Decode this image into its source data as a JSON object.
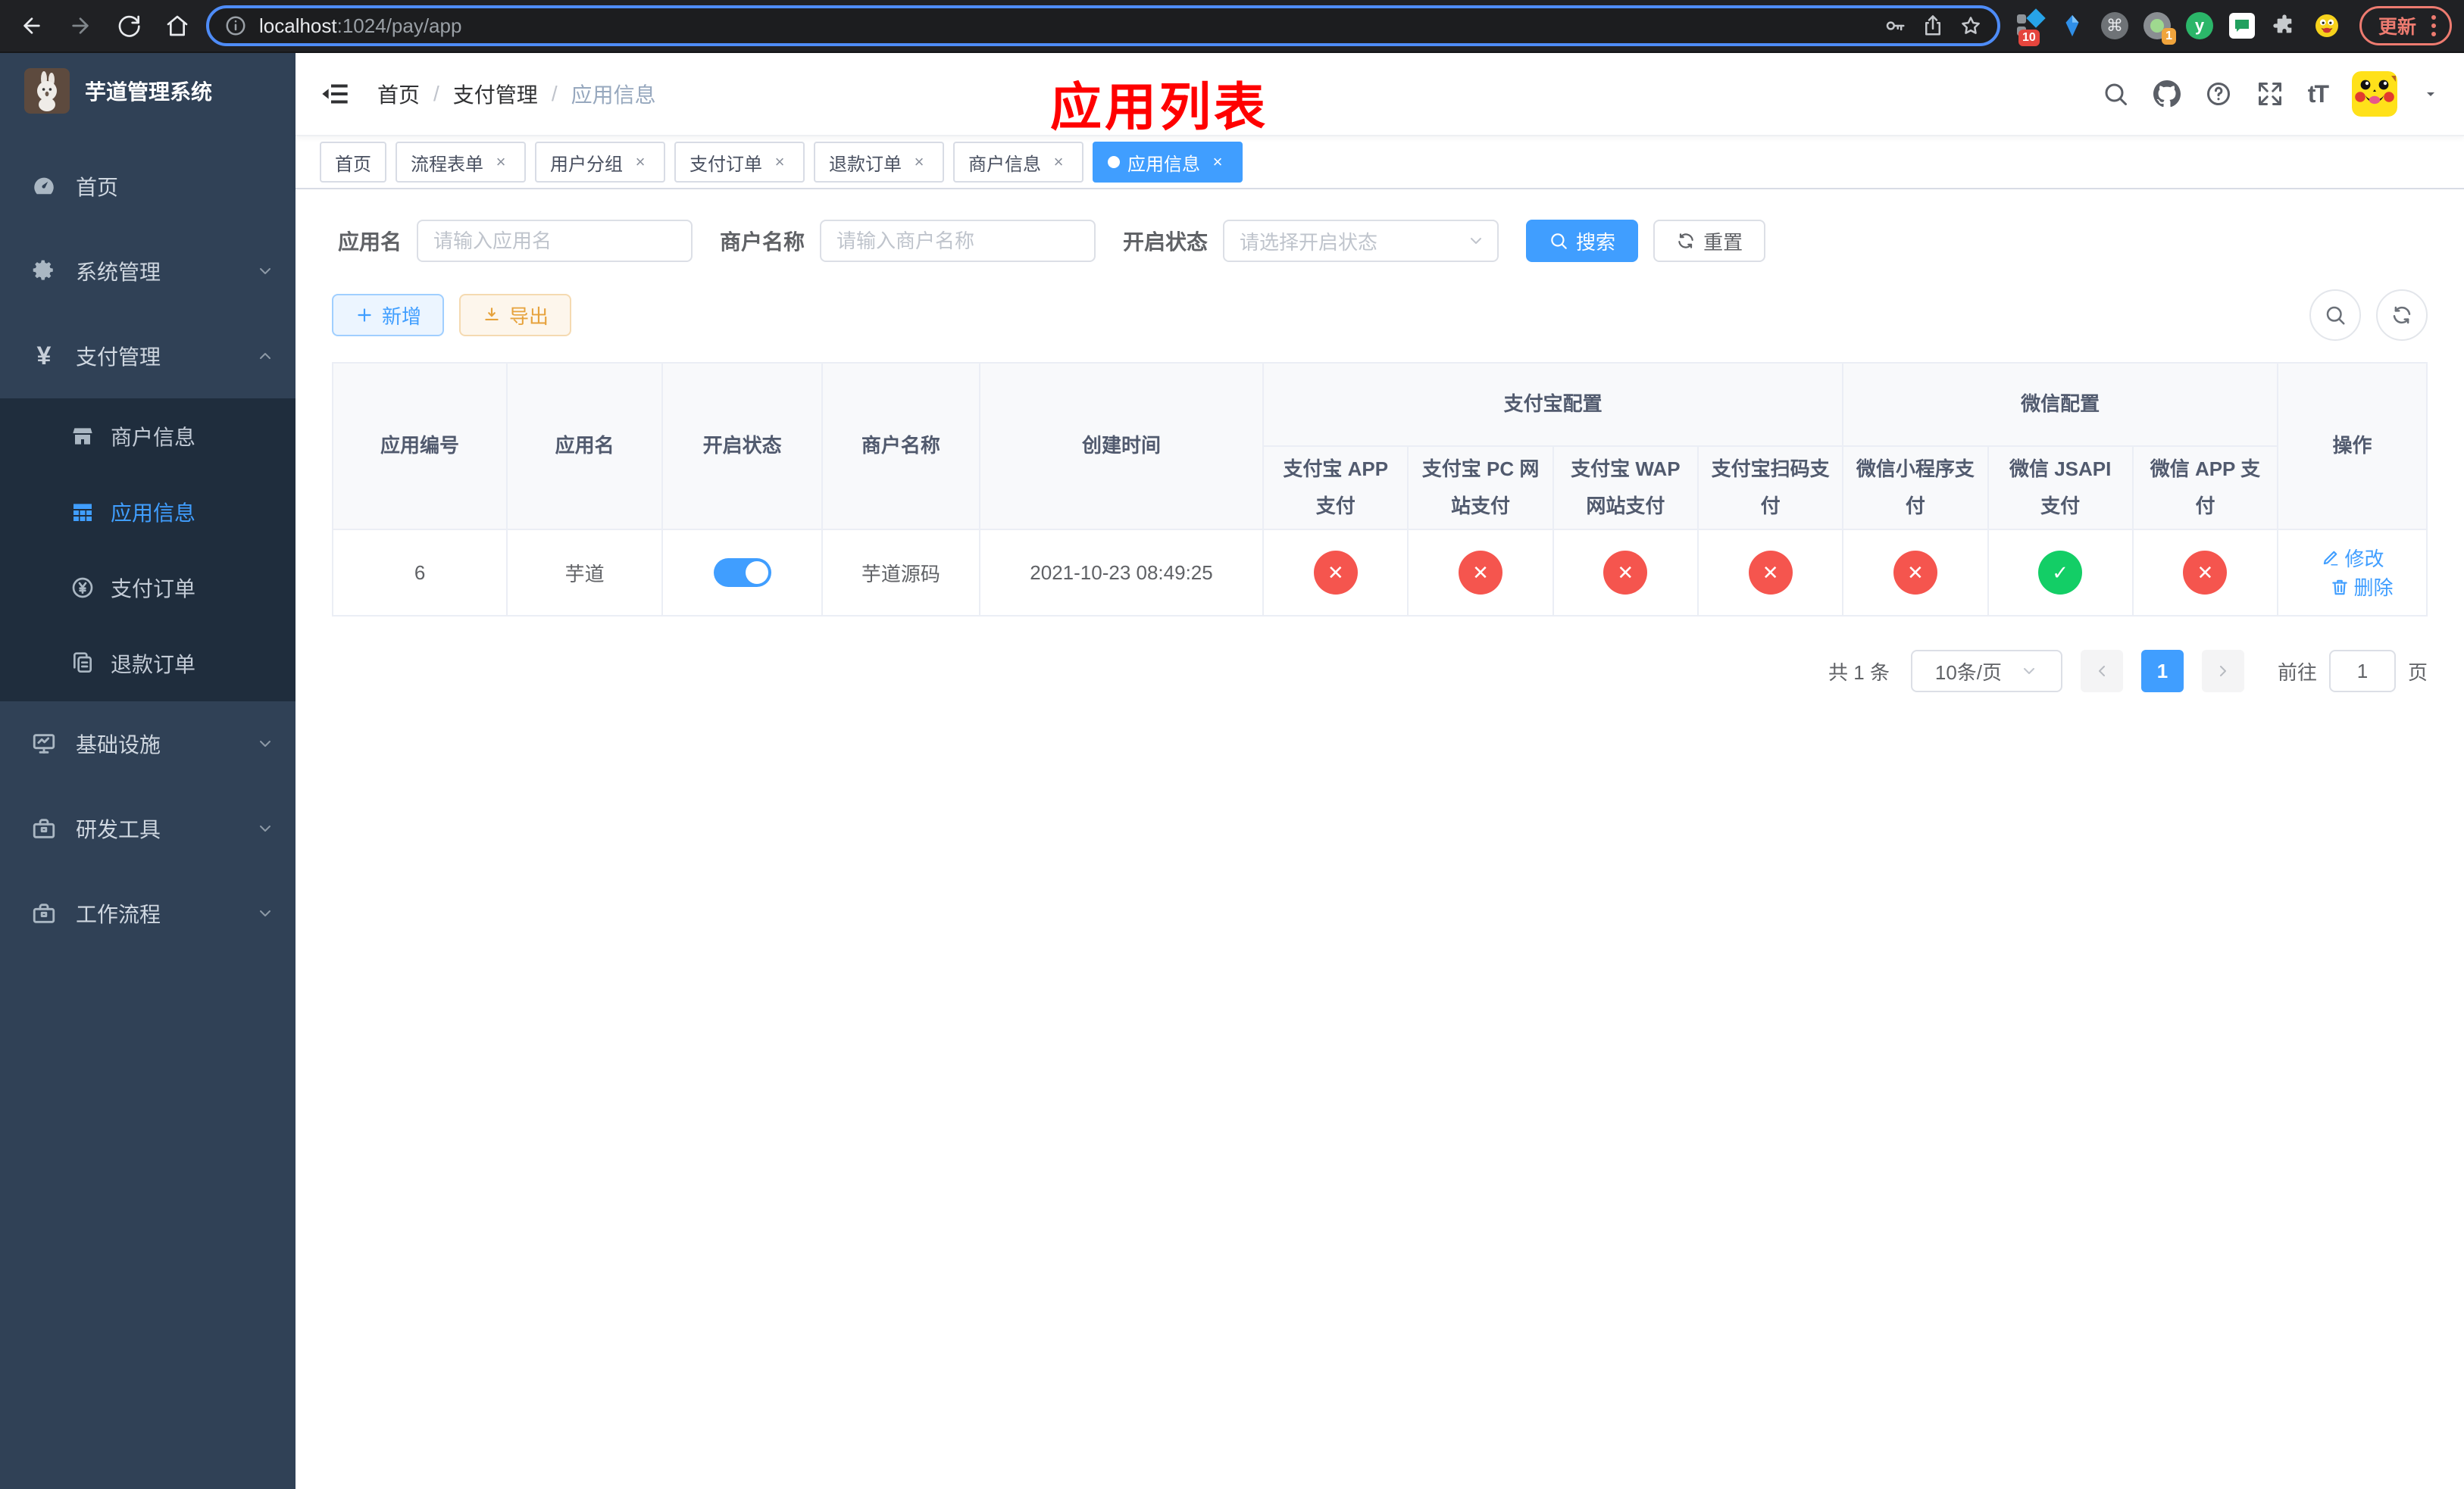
{
  "browser": {
    "url_host": "localhost",
    "url_path": ":1024/pay/app",
    "update_label": "更新",
    "ext_badge_collector": "10",
    "ext_badge_proxy": "1",
    "command_symbol": "⌘",
    "y_letter": "y"
  },
  "sidebar": {
    "title": "芋道管理系统",
    "items": [
      {
        "label": "首页"
      },
      {
        "label": "系统管理"
      },
      {
        "label": "支付管理"
      },
      {
        "label": "基础设施"
      },
      {
        "label": "研发工具"
      },
      {
        "label": "工作流程"
      }
    ],
    "pay_children": [
      {
        "label": "商户信息"
      },
      {
        "label": "应用信息"
      },
      {
        "label": "支付订单"
      },
      {
        "label": "退款订单"
      }
    ],
    "yen_symbol": "¥"
  },
  "header": {
    "breadcrumbs": [
      "首页",
      "支付管理",
      "应用信息"
    ],
    "separator": "/",
    "annotation": "应用列表",
    "font_icon_text": "tT"
  },
  "tabs": [
    {
      "label": "首页"
    },
    {
      "label": "流程表单"
    },
    {
      "label": "用户分组"
    },
    {
      "label": "支付订单"
    },
    {
      "label": "退款订单"
    },
    {
      "label": "商户信息"
    },
    {
      "label": "应用信息"
    }
  ],
  "close_glyph": "×",
  "filters": {
    "app_name_label": "应用名",
    "app_name_placeholder": "请输入应用名",
    "merchant_label": "商户名称",
    "merchant_placeholder": "请输入商户名称",
    "status_label": "开启状态",
    "status_placeholder": "请选择开启状态",
    "search_label": "搜索",
    "reset_label": "重置"
  },
  "toolbar": {
    "add_label": "新增",
    "export_label": "导出"
  },
  "table": {
    "columns": [
      "应用编号",
      "应用名",
      "开启状态",
      "商户名称",
      "创建时间"
    ],
    "groups": [
      {
        "label": "支付宝配置",
        "columns": [
          "支付宝 APP 支付",
          "支付宝 PC 网站支付",
          "支付宝 WAP 网站支付",
          "支付宝扫码支付"
        ]
      },
      {
        "label": "微信配置",
        "columns": [
          "微信小程序支付",
          "微信 JSAPI 支付",
          "微信 APP 支付"
        ]
      }
    ],
    "action_column": "操作",
    "row": {
      "id": "6",
      "name": "芋道",
      "enabled": true,
      "merchant": "芋道源码",
      "created_at": "2021-10-23 08:49:25",
      "configs": [
        false,
        false,
        false,
        false,
        false,
        true,
        false
      ],
      "edit_label": "修改",
      "delete_label": "删除"
    }
  },
  "pagination": {
    "total_text": "共 1 条",
    "page_size_text": "10条/页",
    "current_page": "1",
    "goto_label": "前往",
    "goto_value": "1",
    "page_unit": "页"
  },
  "colors": {
    "primary": "#409eff",
    "success": "#13ce66",
    "danger": "#f5554e",
    "warning": "#e6a23c",
    "sidebar_bg": "#304156",
    "submenu_bg": "#1f2d3d",
    "annotation": "#ff0000"
  }
}
